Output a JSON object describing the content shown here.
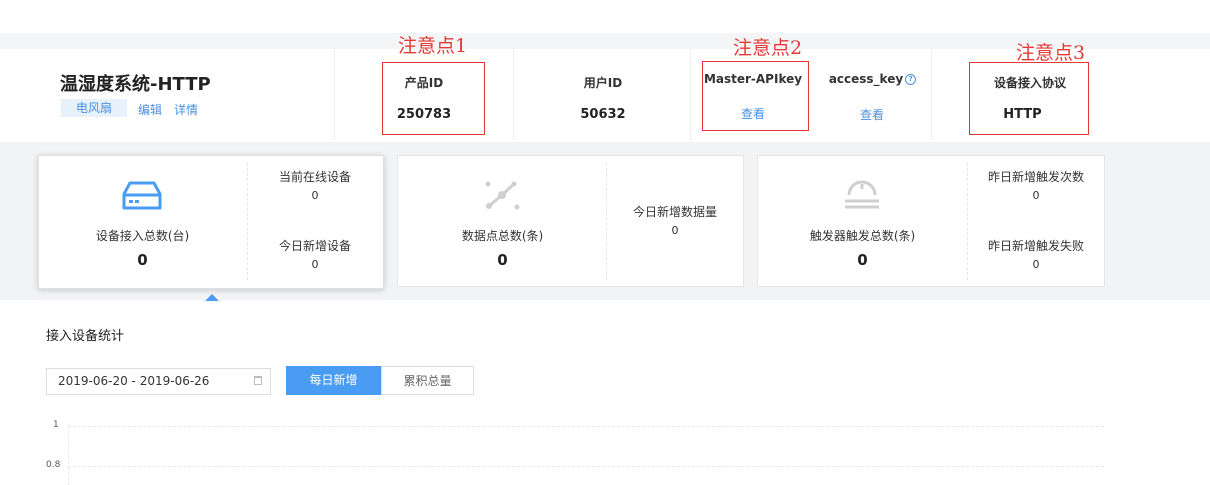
{
  "product": {
    "title": "温湿度系统-HTTP",
    "tag": "电风扇",
    "edit_link": "编辑",
    "detail_link": "详情"
  },
  "header_fields": {
    "product_id_label": "产品ID",
    "product_id_value": "250783",
    "user_id_label": "用户ID",
    "user_id_value": "50632",
    "master_apikey_label": "Master-APIkey",
    "master_apikey_action": "查看",
    "access_key_label": "access_key",
    "access_key_action": "查看",
    "protocol_label": "设备接入协议",
    "protocol_value": "HTTP"
  },
  "annotations": [
    "注意点1",
    "注意点2",
    "注意点3"
  ],
  "cards": {
    "devices": {
      "label": "设备接入总数(台)",
      "value": "0",
      "online_label": "当前在线设备",
      "online_value": "0",
      "new_today_label": "今日新增设备",
      "new_today_value": "0"
    },
    "datapoints": {
      "label": "数据点总数(条)",
      "value": "0",
      "new_today_label": "今日新增数据量",
      "new_today_value": "0"
    },
    "triggers": {
      "label": "触发器触发总数(条)",
      "value": "0",
      "yesterday_trigger_label": "昨日新增触发次数",
      "yesterday_trigger_value": "0",
      "yesterday_fail_label": "昨日新增触发失败",
      "yesterday_fail_value": "0"
    }
  },
  "stats_section": {
    "title": "接入设备统计",
    "date_range": "2019-06-20 - 2019-06-26",
    "tab_daily": "每日新增",
    "tab_cumulative": "累积总量"
  },
  "chart_data": {
    "type": "line",
    "y_ticks": [
      "1",
      "0.8"
    ],
    "series": []
  },
  "colors": {
    "accent": "#4a9cf2",
    "annotation": "#e53935"
  }
}
